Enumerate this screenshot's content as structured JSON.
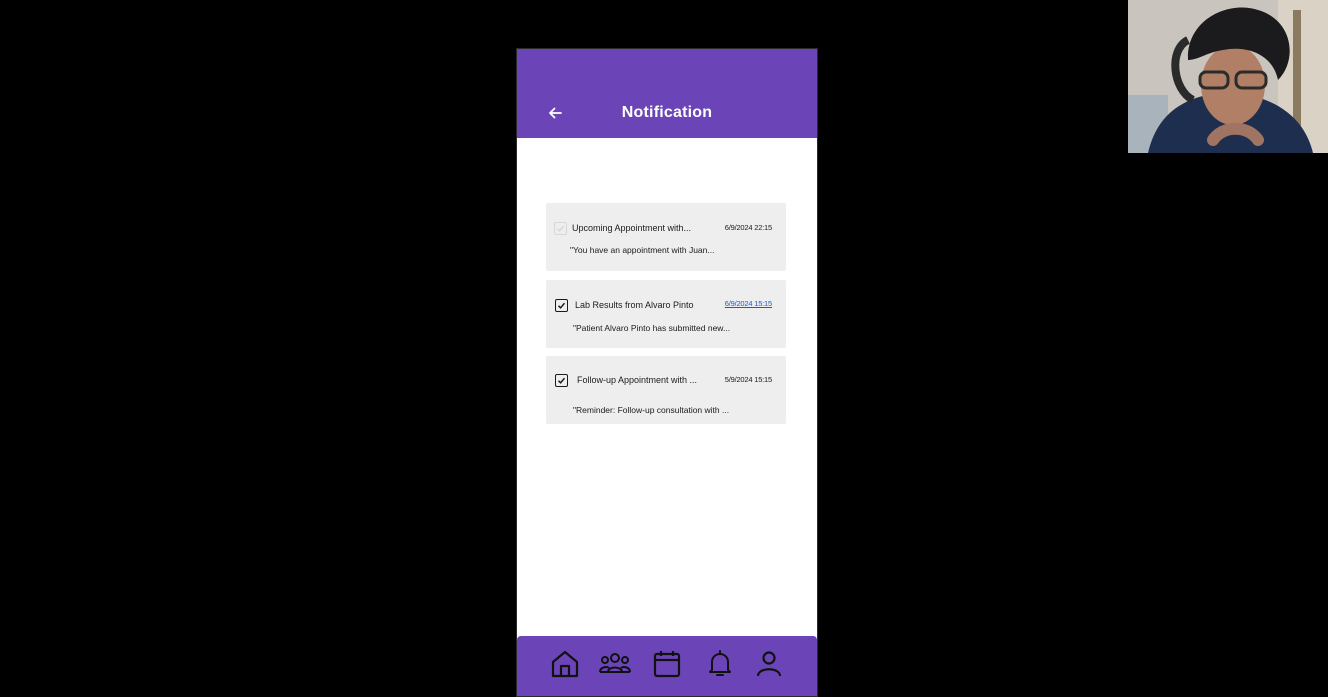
{
  "header": {
    "title": "Notification"
  },
  "notifications": [
    {
      "subject": "Upcoming Appointment with...",
      "date": "6/9/2024 22:15",
      "body": "\"You have an appointment with Juan...",
      "checked": false
    },
    {
      "subject": "Lab Results from Alvaro Pinto",
      "date": "6/9/2024 15:15",
      "body": "\"Patient Alvaro Pinto has submitted new...",
      "checked": true
    },
    {
      "subject": "Follow-up Appointment with ...",
      "date": "5/9/2024 15:15",
      "body": "\"Reminder: Follow-up consultation with ...",
      "checked": true
    }
  ],
  "bottom_nav": {
    "items": [
      {
        "icon": "home-icon"
      },
      {
        "icon": "people-icon"
      },
      {
        "icon": "calendar-icon"
      },
      {
        "icon": "bell-icon"
      },
      {
        "icon": "profile-icon"
      }
    ]
  },
  "colors": {
    "accent": "#6b45b8",
    "card_bg": "#eeeeee",
    "background": "#000000",
    "link": "#1a5bd1"
  }
}
